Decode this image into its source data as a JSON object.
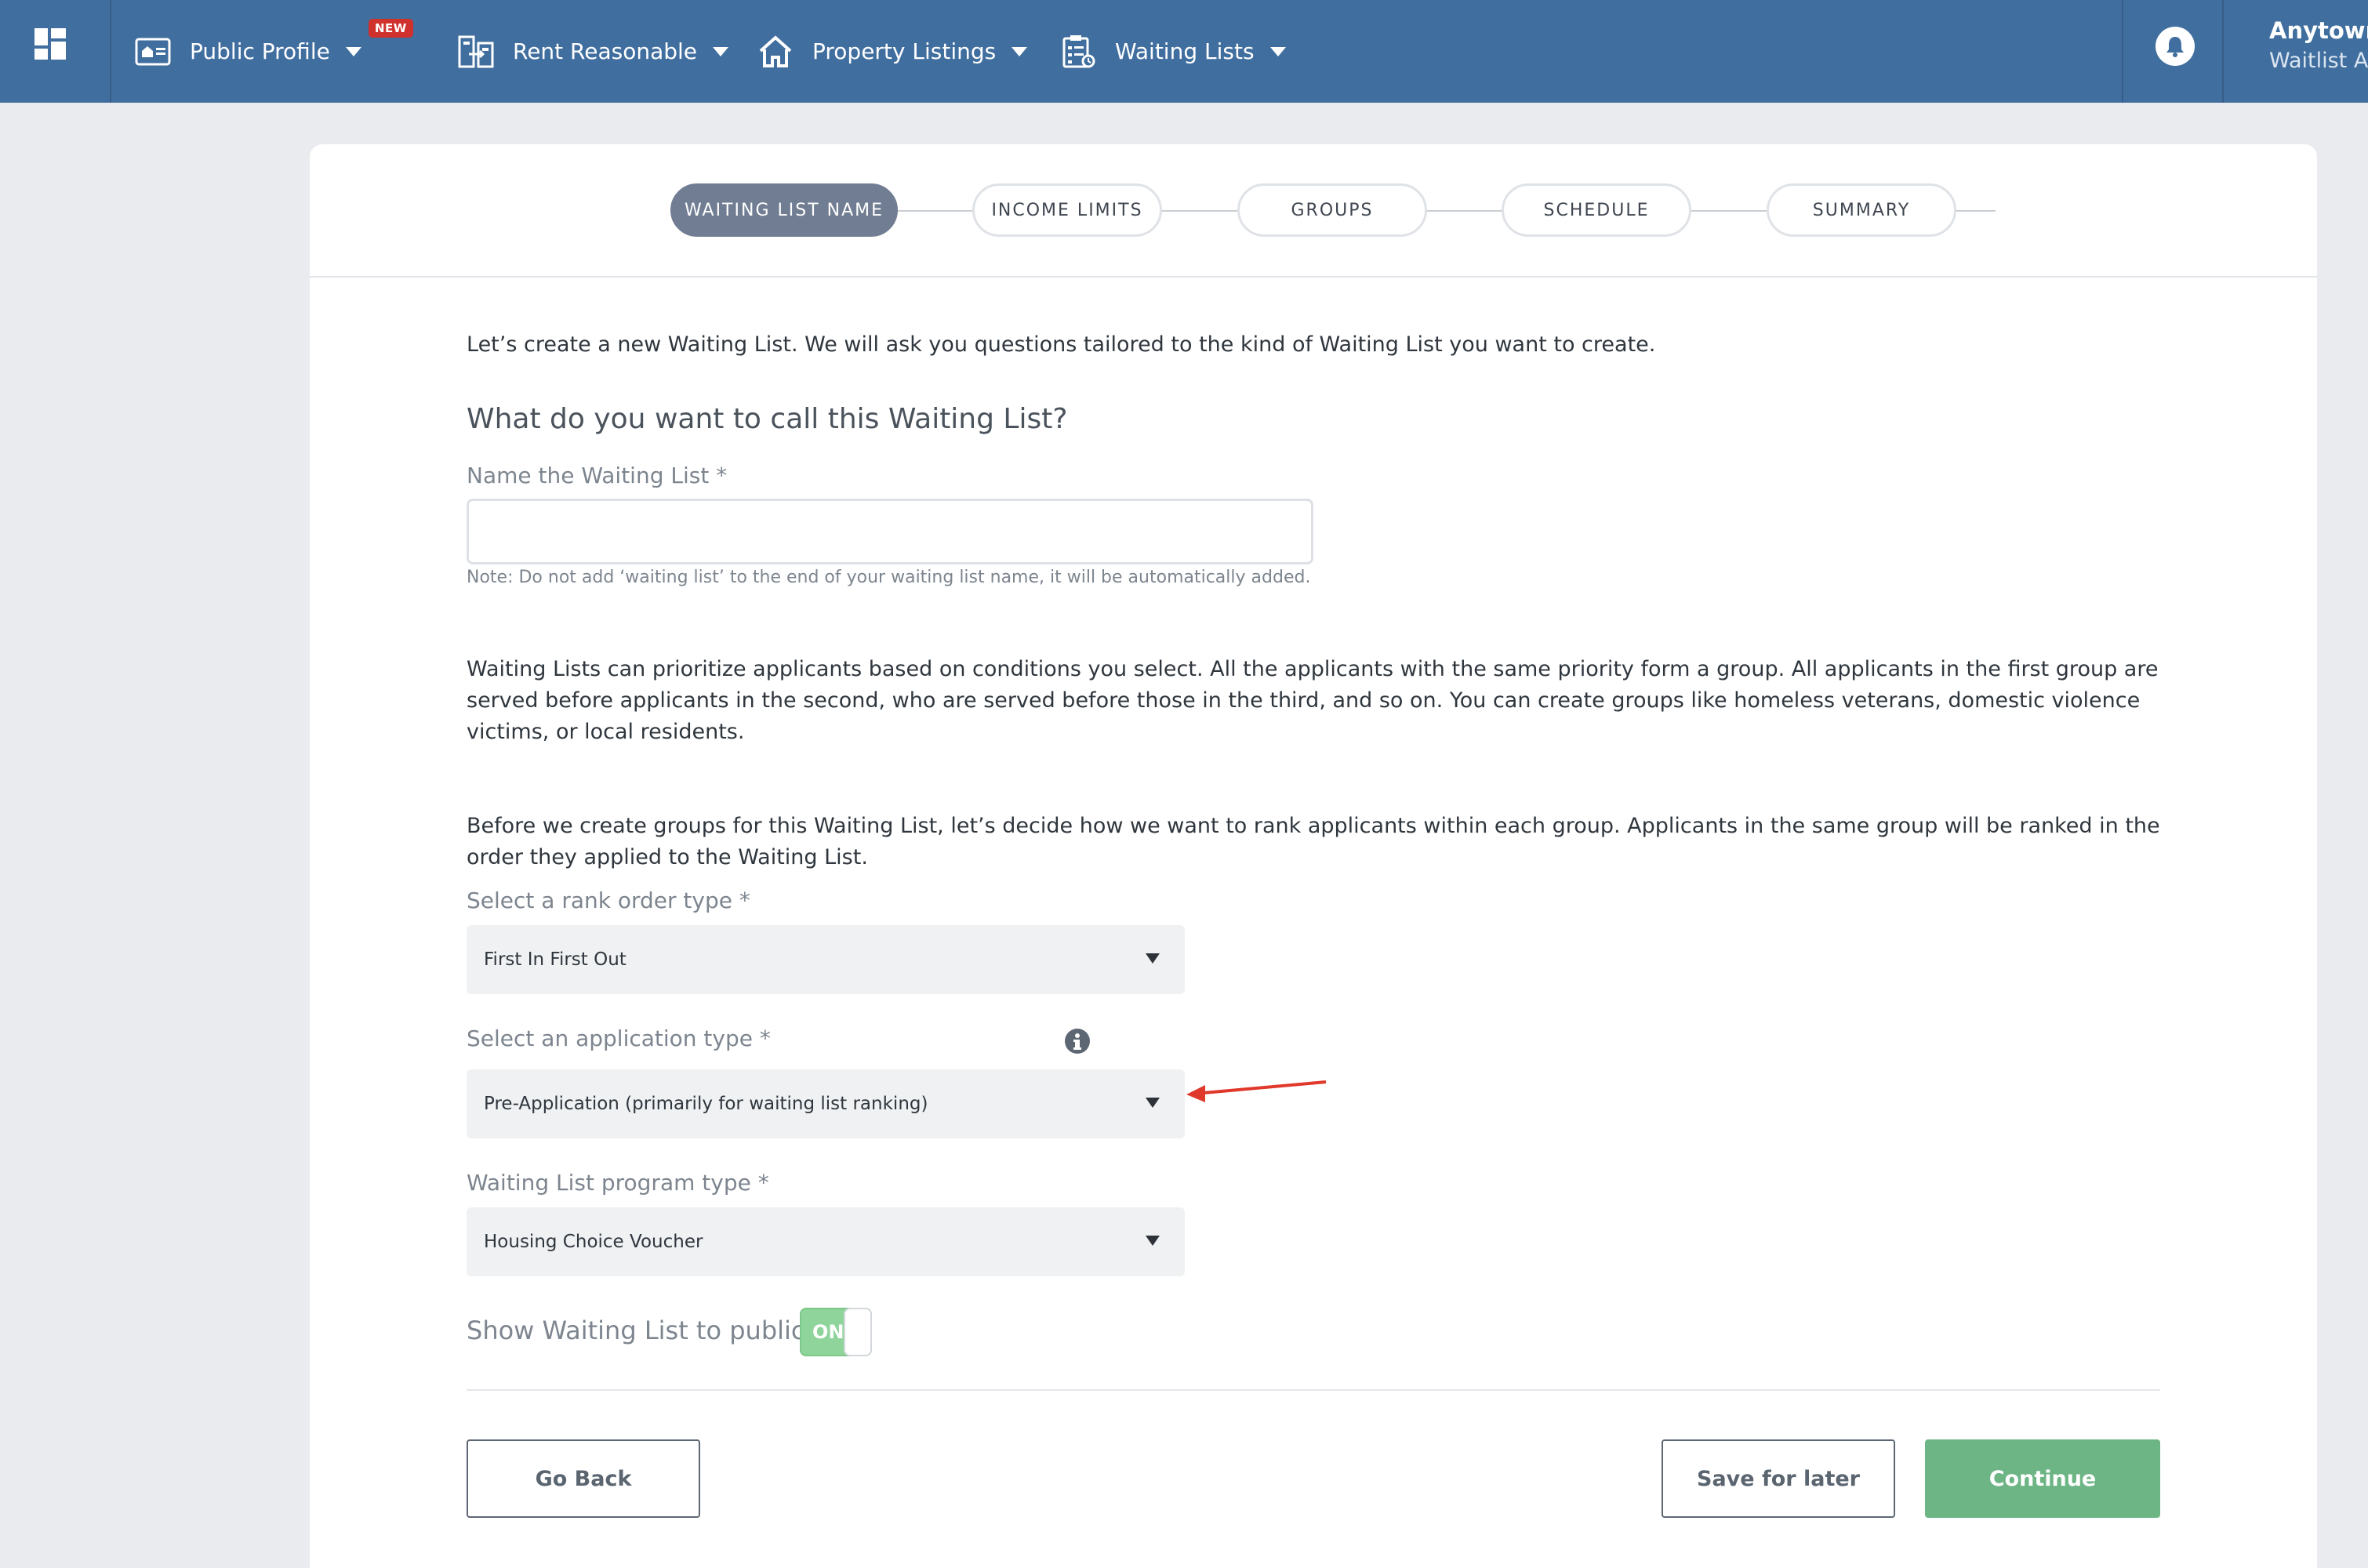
{
  "nav": {
    "items": [
      {
        "label": "Public Profile",
        "icon": "profile-card-icon"
      },
      {
        "label": "Rent Reasonable",
        "icon": "compare-buildings-icon"
      },
      {
        "label": "Property Listings",
        "icon": "house-icon"
      },
      {
        "label": "Waiting Lists",
        "icon": "clipboard-list-icon"
      }
    ],
    "new_badge": "NEW",
    "user": {
      "name": "Anytown",
      "role": "Waitlist A"
    }
  },
  "stepper": {
    "steps": [
      "WAITING LIST NAME",
      "INCOME LIMITS",
      "GROUPS",
      "SCHEDULE",
      "SUMMARY"
    ],
    "active_index": 0
  },
  "form": {
    "intro": "Let’s create a new Waiting List. We will ask you questions tailored to the kind of Waiting List you want to create.",
    "question": "What do you want to call this Waiting List?",
    "name_label": "Name the Waiting List *",
    "name_value": "",
    "name_note": "Note: Do not add ‘waiting list’ to the end of your waiting list name, it will be automatically added.",
    "groups_paragraph": "Waiting Lists can prioritize applicants based on conditions you select. All the applicants with the same priority form a group. All applicants in the first group are served before applicants in the second, who are served before those in the third, and so on. You can create groups like homeless veterans, domestic violence victims, or local residents.",
    "rank_paragraph": "Before we create groups for this Waiting List, let’s decide how we want to rank applicants within each group. Applicants in the same group will be ranked in the order they applied to the Waiting List.",
    "rank_label": "Select a rank order type *",
    "rank_value": "First In First Out",
    "application_label": "Select an application type *",
    "application_value": "Pre-Application (primarily for waiting list ranking)",
    "program_label": "Waiting List program type *",
    "program_value": "Housing Choice Voucher",
    "public_label": "Show Waiting List to public",
    "public_toggle": "ON"
  },
  "buttons": {
    "back": "Go Back",
    "save": "Save for later",
    "continue": "Continue"
  },
  "colors": {
    "nav_bg": "#406e9f",
    "step_active": "#717d92",
    "continue_bg": "#6db585",
    "toggle_on": "#8fd49a",
    "annotation_arrow": "#e0392b"
  }
}
